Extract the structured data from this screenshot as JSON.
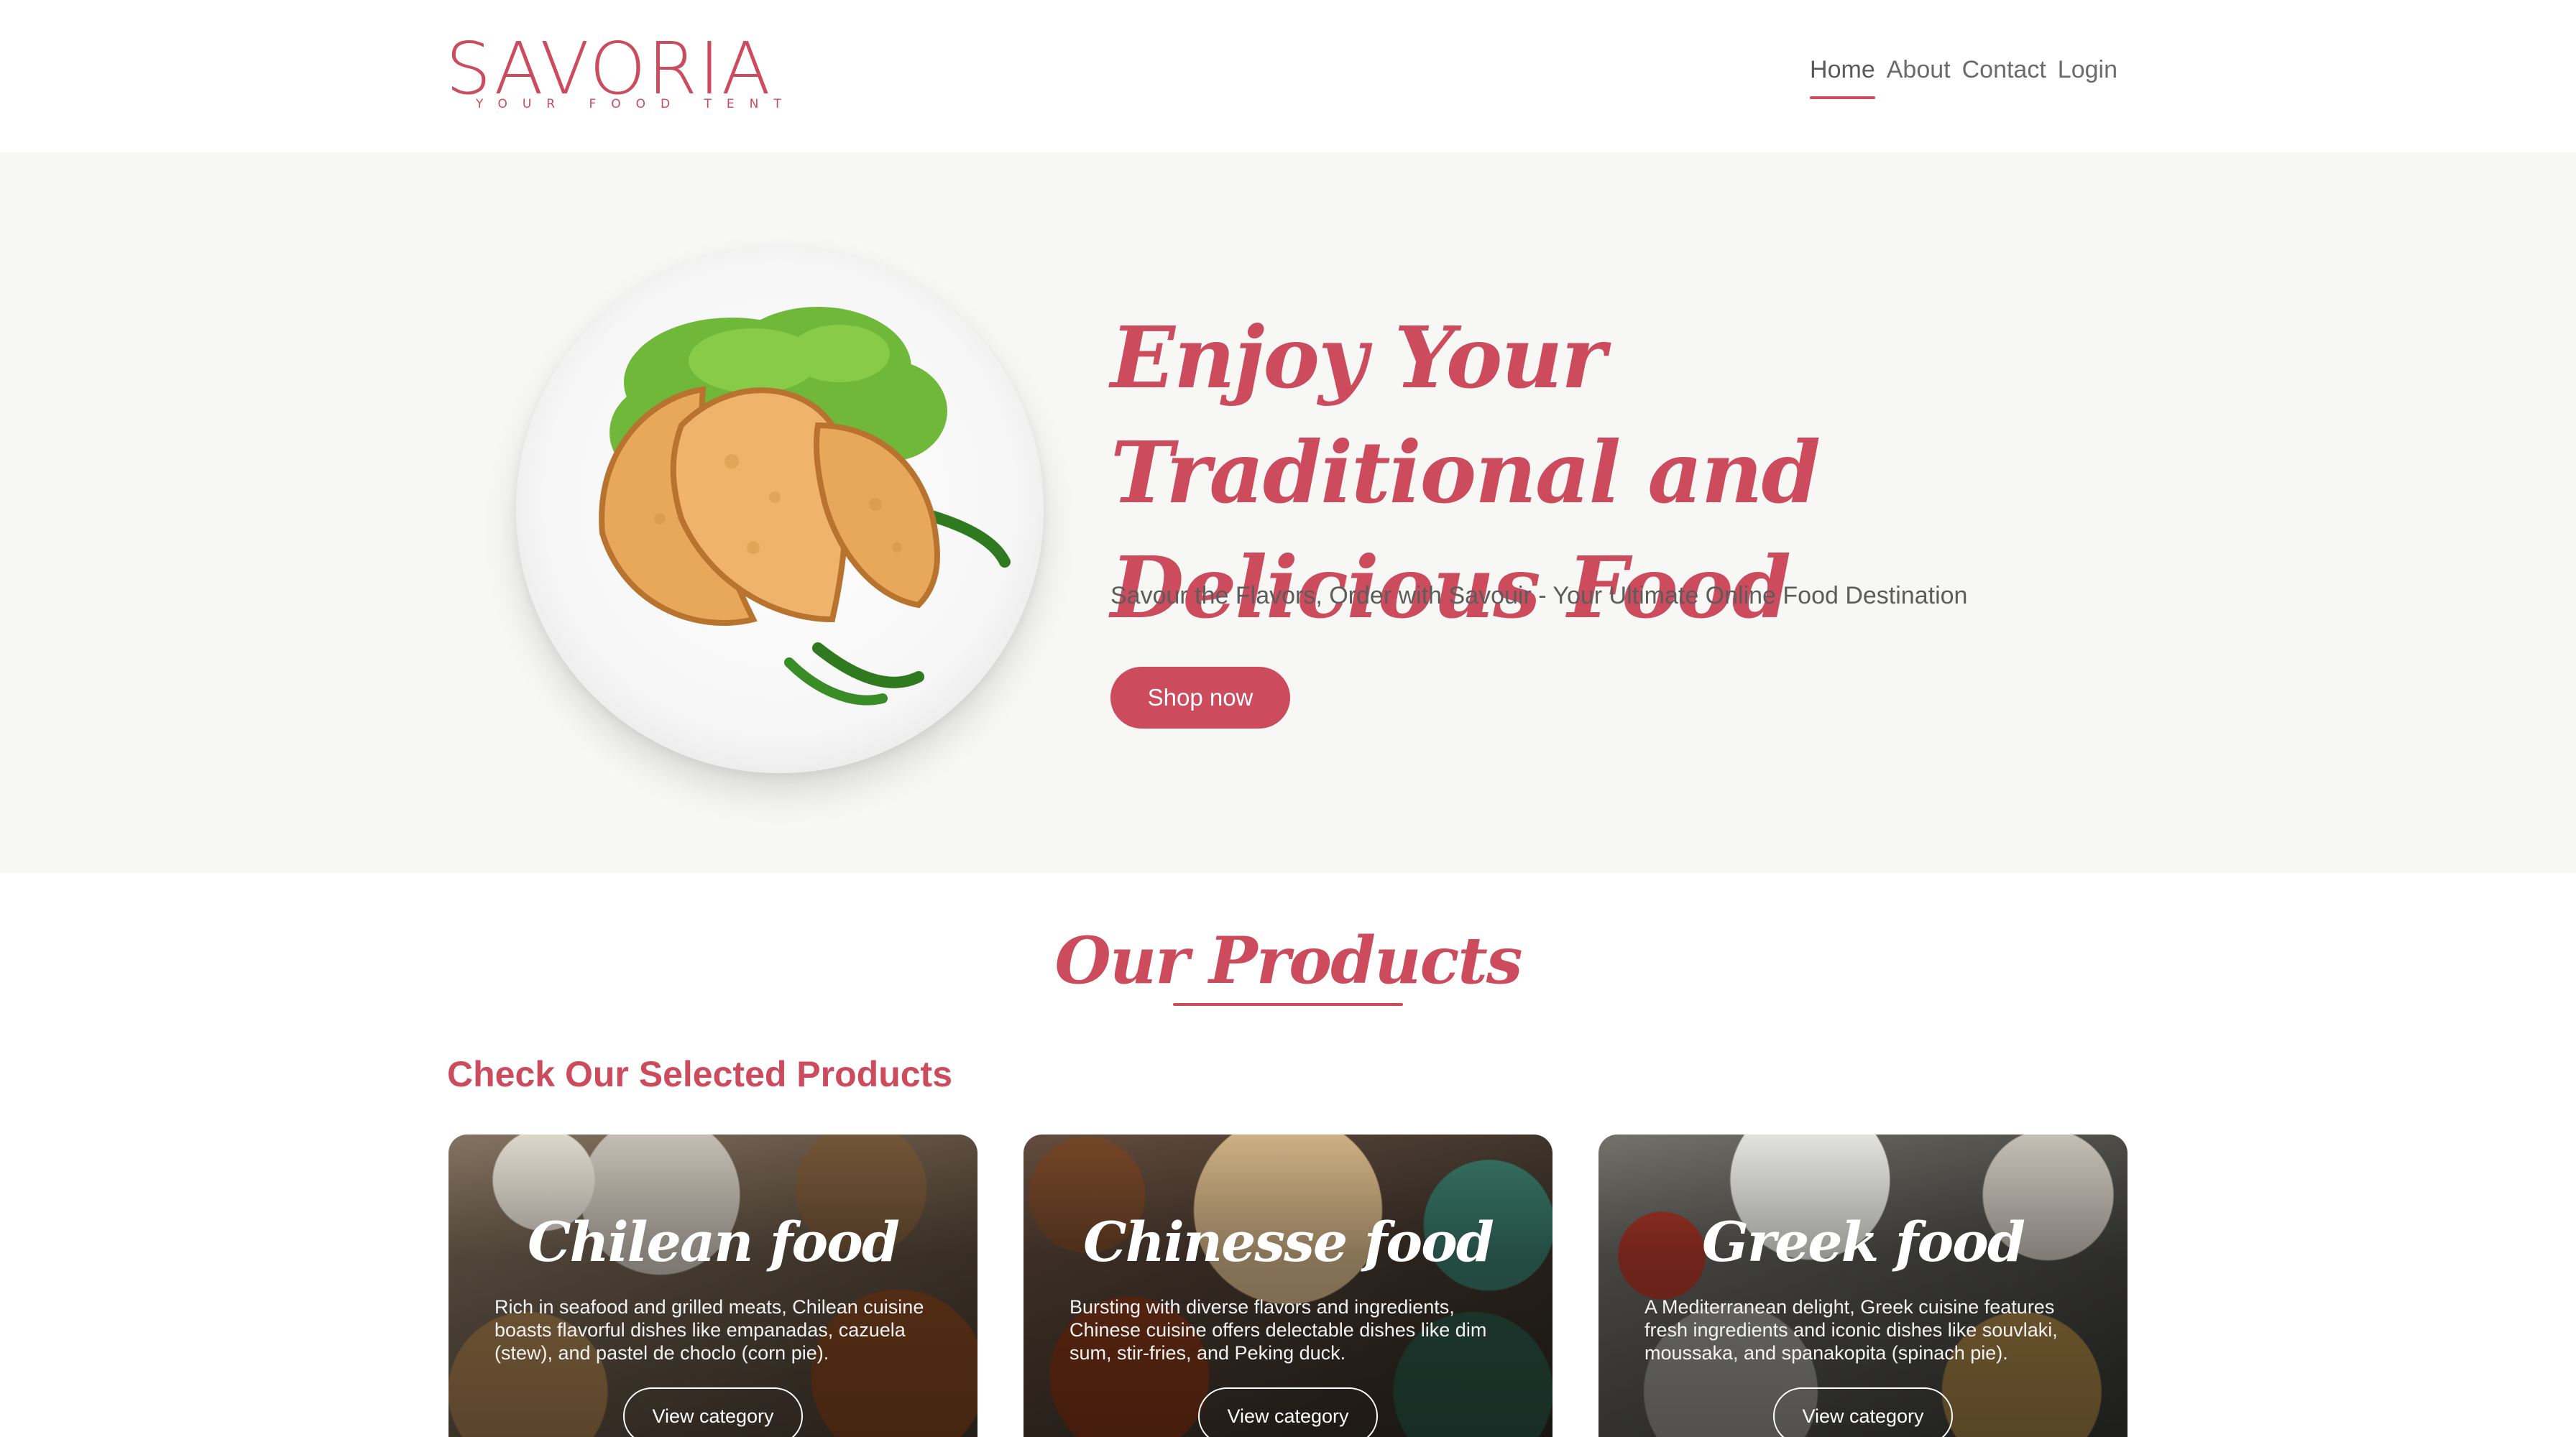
{
  "brand": {
    "name": "SAVORIA",
    "tagline": "YOUR FOOD TENT",
    "accent_color": "#cc4b5c"
  },
  "nav": {
    "items": [
      {
        "label": "Home",
        "active": true
      },
      {
        "label": "About",
        "active": false
      },
      {
        "label": "Contact",
        "active": false
      },
      {
        "label": "Login",
        "active": false
      }
    ]
  },
  "hero": {
    "title": "Enjoy Your Traditional and Delicious Food",
    "subtitle": "Savour the Flavors, Order with Savouir - Your Ultimate Online Food Destination",
    "button_label": "Shop now",
    "image_icon": "empanada-plate-image"
  },
  "products": {
    "title": "Our Products",
    "subtitle": "Check Our Selected Products",
    "cards": [
      {
        "title": "Chilean food",
        "description": "Rich in seafood and grilled meats, Chilean cuisine boasts flavorful dishes like empanadas, cazuela (stew), and pastel de choclo (corn pie).",
        "button_label": "View category"
      },
      {
        "title": "Chinesse food",
        "description": "Bursting with diverse flavors and ingredients, Chinese cuisine offers delectable dishes like dim sum, stir-fries, and Peking duck.",
        "button_label": "View category"
      },
      {
        "title": "Greek food",
        "description": "A Mediterranean delight, Greek cuisine features fresh ingredients and iconic dishes like souvlaki, moussaka, and spanakopita (spinach pie).",
        "button_label": "View category"
      }
    ]
  }
}
